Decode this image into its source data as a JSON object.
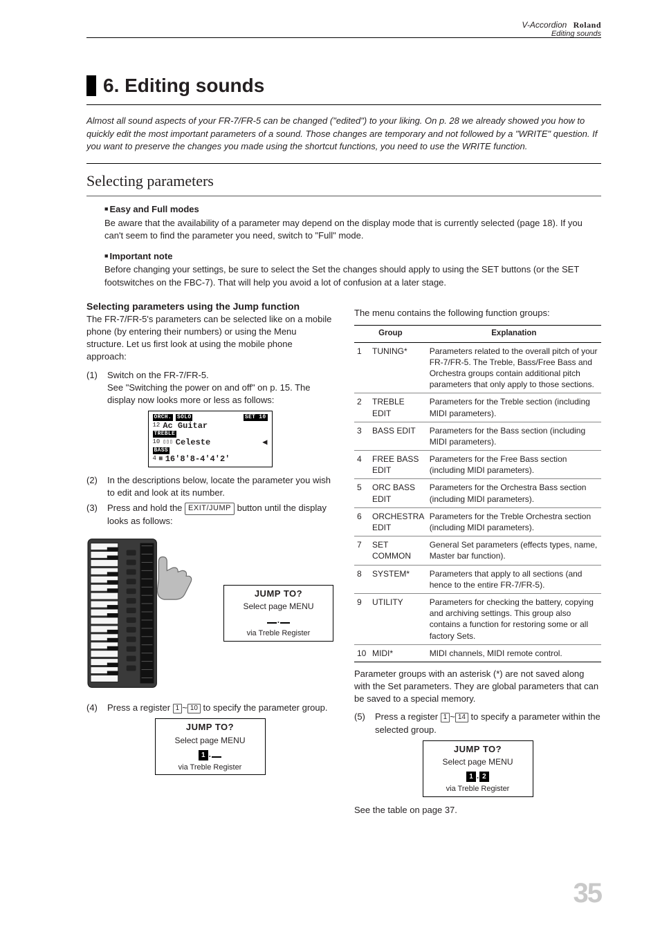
{
  "header": {
    "product": "V-Accordion",
    "brand": "Roland",
    "subtitle": "Editing sounds"
  },
  "chapter_title": "6. Editing sounds",
  "intro": "Almost all sound aspects of your FR-7/FR-5 can be changed (\"edited\") to your liking. On p. 28 we already showed you how to quickly edit the most important parameters of a sound. Those changes are temporary and not followed by a \"WRITE\" question. If you want to preserve the changes you made using the shortcut functions, you need to use the WRITE function.",
  "section_title": "Selecting parameters",
  "easy_full": {
    "label": "Easy and Full modes",
    "body": "Be aware that the availability of a parameter may depend on the display mode that is currently selected (page 18). If you can't seem to find the parameter you need, switch to \"Full\" mode."
  },
  "important": {
    "label": "Important note",
    "body": "Before changing your settings, be sure to select the Set the changes should apply to using the SET buttons (or the SET footswitches on the FBC-7). That will help you avoid a lot of confusion at a later stage."
  },
  "left": {
    "h3": "Selecting parameters using the Jump function",
    "p1": "The FR-7/FR-5's parameters can be selected like on a mobile phone (by entering their numbers) or using the Menu structure. Let us first look at using the mobile phone approach:",
    "step1_num": "(1)",
    "step1_lead": "Switch on the FR-7/FR-5.",
    "step1_body": "See \"Switching the power on and off\" on p. 15. The display now looks more or less as follows:",
    "lcd1": {
      "orch": "ORCH.",
      "solo": "SOLO",
      "setlabel": "SET 10",
      "twelve": "12",
      "line1b": "Ac Guitar",
      "treble": "TREBLE",
      "ten": "10",
      "line2b": "Celeste",
      "bass": "BASS",
      "four": "4",
      "line3b": "16'8'8-4'4'2'"
    },
    "step2_num": "(2)",
    "step2_body": "In the descriptions below, locate the parameter you wish to edit and look at its number.",
    "step3_num": "(3)",
    "step3_lead": "Press and hold the ",
    "step3_btn": "EXIT/JUMP",
    "step3_tail": " button until the display looks as follows:",
    "step4_num": "(4)",
    "step4_lead": "Press a register ",
    "step4_r1": "1",
    "step4_tilde": "~",
    "step4_r2": "10",
    "step4_tail": " to specify the parameter group."
  },
  "right": {
    "intro": "The menu contains the following function groups:",
    "th_group": "Group",
    "th_expl": "Explanation",
    "rows": [
      {
        "n": "1",
        "g": "TUNING*",
        "e": "Parameters related to the overall pitch of your FR-7/FR-5. The Treble, Bass/Free Bass and Orchestra groups contain additional pitch parameters that only apply to those sections."
      },
      {
        "n": "2",
        "g": "TREBLE EDIT",
        "e": "Parameters for the Treble section (including MIDI parameters)."
      },
      {
        "n": "3",
        "g": "BASS EDIT",
        "e": "Parameters for the Bass section (including MIDI parameters)."
      },
      {
        "n": "4",
        "g": "FREE BASS EDIT",
        "e": "Parameters for the Free Bass section (including MIDI parameters)."
      },
      {
        "n": "5",
        "g": "ORC BASS EDIT",
        "e": "Parameters for the Orchestra Bass section (including MIDI parameters)."
      },
      {
        "n": "6",
        "g": "ORCHESTRA EDIT",
        "e": "Parameters for the Treble Orchestra section (including MIDI parameters)."
      },
      {
        "n": "7",
        "g": "SET COMMON",
        "e": "General Set parameters (effects types, name, Master bar function)."
      },
      {
        "n": "8",
        "g": "SYSTEM*",
        "e": "Parameters that apply to all sections (and hence to the entire FR-7/FR-5)."
      },
      {
        "n": "9",
        "g": "UTILITY",
        "e": "Parameters for checking the battery, copying and archiving settings. This group also contains a function for restoring some or all factory Sets."
      },
      {
        "n": "10",
        "g": "MIDI*",
        "e": "MIDI channels, MIDI remote control."
      }
    ],
    "asterisk_note": "Parameter groups with an asterisk (*) are not saved along with the Set parameters. They are global parameters that can be saved to a special memory.",
    "step5_num": "(5)",
    "step5_lead": "Press a register ",
    "step5_r1": "1",
    "step5_tilde": "~",
    "step5_r2": "14",
    "step5_tail": " to specify a parameter within the selected group.",
    "see_table": "See the table on page 37."
  },
  "jump": {
    "title": "JUMP TO?",
    "select": "Select page  MENU",
    "via": "via Treble Register",
    "d1": "1",
    "d2": "2"
  },
  "page_number": "35"
}
